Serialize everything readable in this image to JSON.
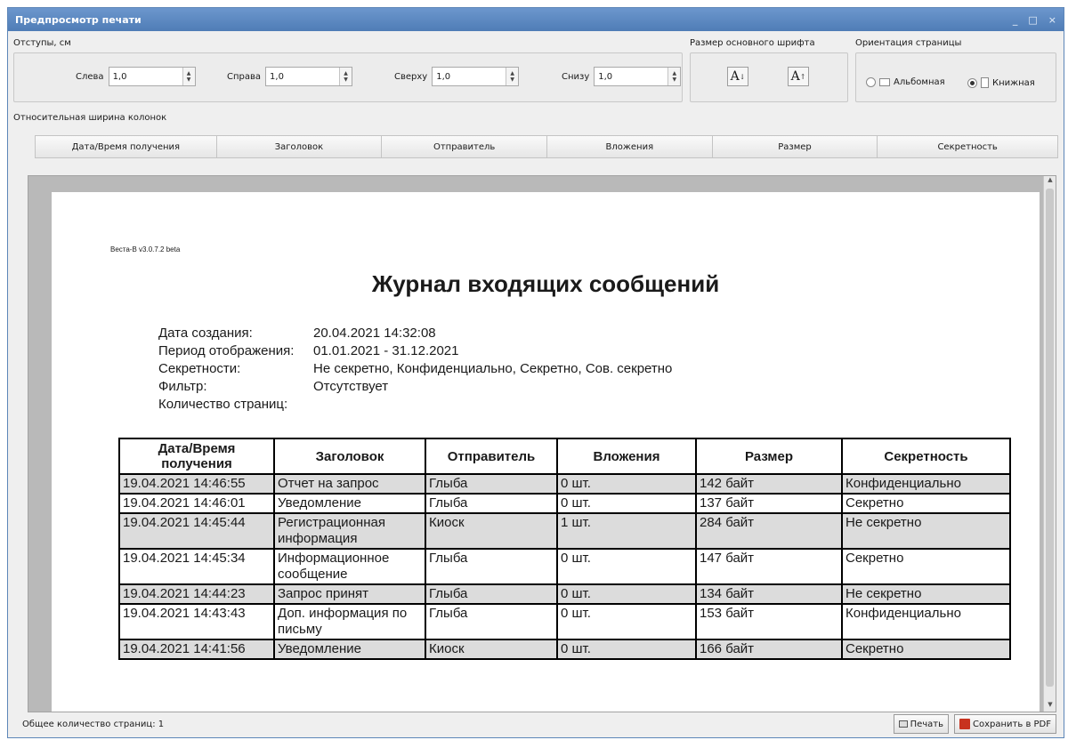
{
  "window": {
    "title": "Предпросмотр печати",
    "minimize": "_",
    "maximize": "□",
    "close": "×"
  },
  "margins": {
    "label": "Отступы, см",
    "fields": [
      {
        "label": "Слева",
        "value": "1,0"
      },
      {
        "label": "Справа",
        "value": "1,0"
      },
      {
        "label": "Сверху",
        "value": "1,0"
      },
      {
        "label": "Снизу",
        "value": "1,0"
      }
    ]
  },
  "font_size": {
    "label": "Размер основного шрифта",
    "decrease_glyph": "A",
    "increase_glyph": "A"
  },
  "orientation": {
    "label": "Ориентация страницы",
    "landscape": "Альбомная",
    "portrait": "Книжная",
    "selected": "portrait"
  },
  "column_widths": {
    "label": "Относительная ширина колонок",
    "columns": [
      "Дата/Время получения",
      "Заголовок",
      "Отправитель",
      "Вложения",
      "Размер",
      "Секретность"
    ]
  },
  "document": {
    "app_version": "Веста-В v3.0.7.2 beta",
    "title": "Журнал входящих сообщений",
    "meta": [
      {
        "key": "Дата создания:",
        "value": "20.04.2021 14:32:08"
      },
      {
        "key": "Период отображения:",
        "value": "01.01.2021 - 31.12.2021"
      },
      {
        "key": "Секретности:",
        "value": "Не секретно, Конфиденциально, Секретно, Сов. секретно"
      },
      {
        "key": "Фильтр:",
        "value": "Отсутствует"
      },
      {
        "key": "Количество страниц:",
        "value": ""
      }
    ],
    "table_headers": [
      "Дата/Время получения",
      "Заголовок",
      "Отправитель",
      "Вложения",
      "Размер",
      "Секретность"
    ],
    "rows": [
      [
        "19.04.2021 14:46:55",
        "Отчет на запрос",
        "Глыба",
        "0 шт.",
        "142 байт",
        "Конфиденциально"
      ],
      [
        "19.04.2021 14:46:01",
        "Уведомление",
        "Глыба",
        "0 шт.",
        "137 байт",
        "Секретно"
      ],
      [
        "19.04.2021 14:45:44",
        "Регистрационная информация",
        "Киоск",
        "1 шт.",
        "284 байт",
        "Не секретно"
      ],
      [
        "19.04.2021 14:45:34",
        "Информационное сообщение",
        "Глыба",
        "0 шт.",
        "147 байт",
        "Секретно"
      ],
      [
        "19.04.2021 14:44:23",
        "Запрос принят",
        "Глыба",
        "0 шт.",
        "134 байт",
        "Не секретно"
      ],
      [
        "19.04.2021 14:43:43",
        "Доп. информация по письму",
        "Глыба",
        "0 шт.",
        "153 байт",
        "Конфиденциально"
      ],
      [
        "19.04.2021 14:41:56",
        "Уведомление",
        "Киоск",
        "0 шт.",
        "166 байт",
        "Секретно"
      ]
    ]
  },
  "status": {
    "page_count_text": "Общее количество страниц: 1",
    "print_label": "Печать",
    "save_pdf_label": "Сохранить в PDF"
  }
}
